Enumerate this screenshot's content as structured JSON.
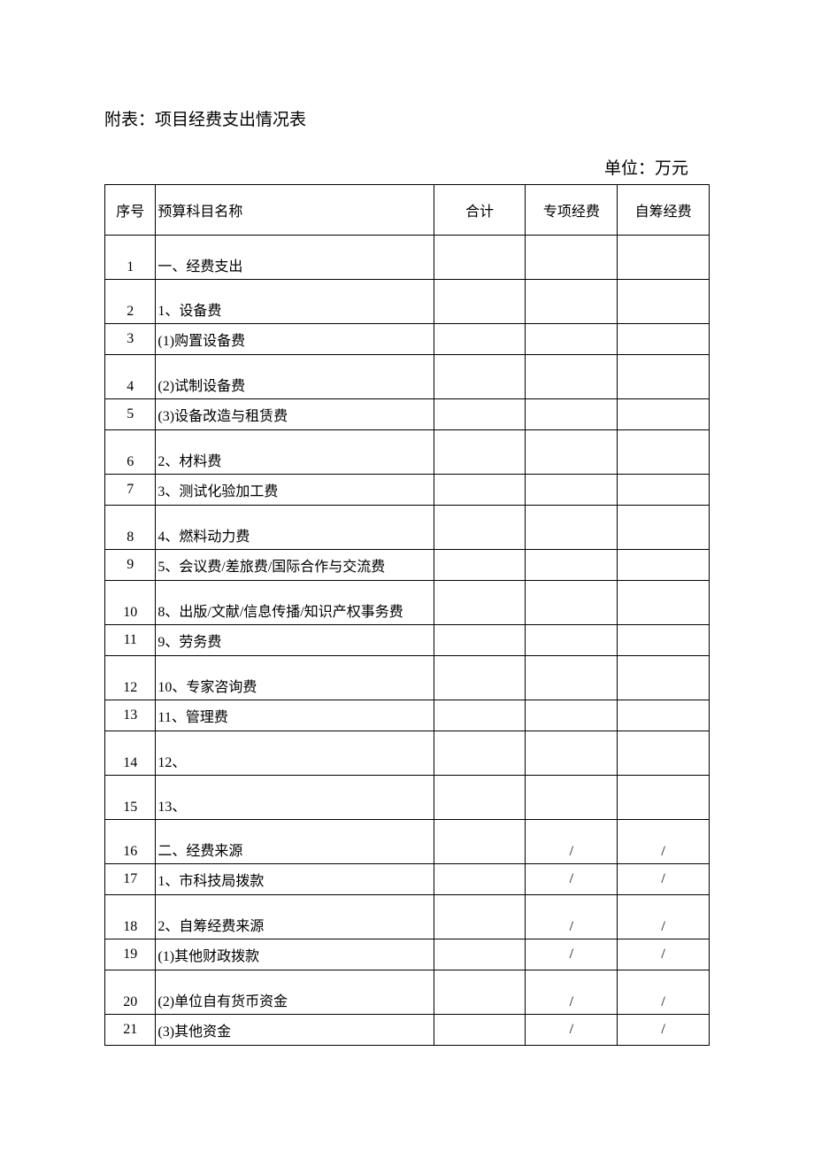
{
  "title": "附表：项目经费支出情况表",
  "unit": "单位：万元",
  "headers": {
    "seq": "序号",
    "name": "预算科目名称",
    "total": "合计",
    "special": "专项经费",
    "self": "自筹经费"
  },
  "rows": [
    {
      "seq": "1",
      "name": "一、经费支出",
      "total": "",
      "special": "",
      "self": "",
      "cls": "tall"
    },
    {
      "seq": "2",
      "name": "1、设备费",
      "total": "",
      "special": "",
      "self": "",
      "cls": "tall"
    },
    {
      "seq": "3",
      "name": "(1)购置设备费",
      "total": "",
      "special": "",
      "self": "",
      "cls": "short"
    },
    {
      "seq": "4",
      "name": "(2)试制设备费",
      "total": "",
      "special": "",
      "self": "",
      "cls": "tall"
    },
    {
      "seq": "5",
      "name": "(3)设备改造与租赁费",
      "total": "",
      "special": "",
      "self": "",
      "cls": "short"
    },
    {
      "seq": "6",
      "name": "2、材料费",
      "total": "",
      "special": "",
      "self": "",
      "cls": "tall"
    },
    {
      "seq": "7",
      "name": "3、测试化验加工费",
      "total": "",
      "special": "",
      "self": "",
      "cls": "short"
    },
    {
      "seq": "8",
      "name": "4、燃料动力费",
      "total": "",
      "special": "",
      "self": "",
      "cls": "tall"
    },
    {
      "seq": "9",
      "name": "5、会议费/差旅费/国际合作与交流费",
      "total": "",
      "special": "",
      "self": "",
      "cls": "short"
    },
    {
      "seq": "10",
      "name": "8、出版/文献/信息传播/知识产权事务费",
      "total": "",
      "special": "",
      "self": "",
      "cls": "tall"
    },
    {
      "seq": "11",
      "name": "9、劳务费",
      "total": "",
      "special": "",
      "self": "",
      "cls": "short"
    },
    {
      "seq": "12",
      "name": "10、专家咨询费",
      "total": "",
      "special": "",
      "self": "",
      "cls": "tall"
    },
    {
      "seq": "13",
      "name": "11、管理费",
      "total": "",
      "special": "",
      "self": "",
      "cls": "short"
    },
    {
      "seq": "14",
      "name": "12、",
      "total": "",
      "special": "",
      "self": "",
      "cls": "tall"
    },
    {
      "seq": "15",
      "name": "13、",
      "total": "",
      "special": "",
      "self": "",
      "cls": "tall"
    },
    {
      "seq": "16",
      "name": "二、经费来源",
      "total": "",
      "special": "/",
      "self": "/",
      "cls": "tall"
    },
    {
      "seq": "17",
      "name": "1、市科技局拨款",
      "total": "",
      "special": "/",
      "self": "/",
      "cls": "short"
    },
    {
      "seq": "18",
      "name": "2、自筹经费来源",
      "total": "",
      "special": "/",
      "self": "/",
      "cls": "tall"
    },
    {
      "seq": "19",
      "name": "(1)其他财政拨款",
      "total": "",
      "special": "/",
      "self": "/",
      "cls": "short"
    },
    {
      "seq": "20",
      "name": "(2)单位自有货币资金",
      "total": "",
      "special": "/",
      "self": "/",
      "cls": "tall"
    },
    {
      "seq": "21",
      "name": "(3)其他资金",
      "total": "",
      "special": "/",
      "self": "/",
      "cls": "short"
    }
  ]
}
